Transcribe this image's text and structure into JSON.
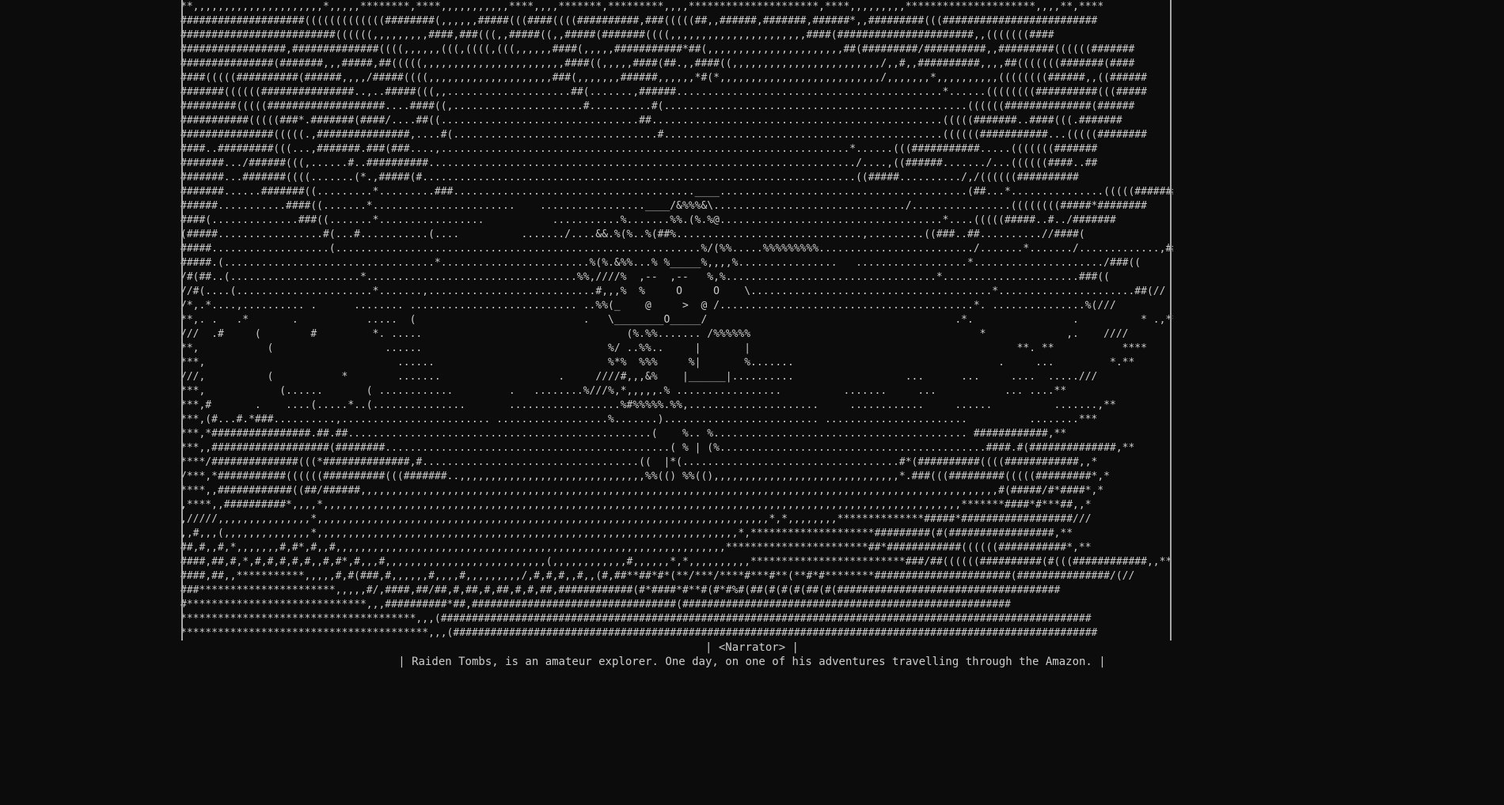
{
  "window": {
    "background": "#0c0c0c",
    "foreground": "#cccccc"
  },
  "art_lines": [
    "**,,,,,,,,,,,,,,,,,,,,,*,,,,,********,****,,,,,,,,,,,****,,,,*******,*********,,,,*********************,****,,,,,,,,,*********************,,,,**,****",
    "####################(((((((((((((########(,,,,,,#####(((####((((##########,###(((((##,,######,#######,######*,,#########(((#########################",
    "#########################((((((,,,,,,,,,####,###(((,,#####((,,#####(#######((((,,,,,,,,,,,,,,,,,,,,,,####(######################,,(((((((####",
    "#################,##############((((,,,,,,(((,((((,(((,,,,,,####(,,,,,###########*##(,,,,,,,,,,,,,,,,,,,,,,##(#########/##########,,#########((((((#######",
    "###############(#######,,,#####,##(((((,,,,,,,,,,,,,,,,,,,,,,,####((,,,,,####(##.,,####((,,,,,,,,,,,,,,,,,,,,,,,,/,,#,,##########,,,,##(((((((#######(####",
    "####(((((##########(######,,,,/#####((((,,,,,,,,,,,,,,,,,,,,###(,,,,,,,######,,,,,,*#(*,,,,,,,,,,,,,,,,,,,,,,,,,,/,,,,,,,*,,,,,,,,,,((((((((######,,((######",
    "#######((((((###############..,..#####(((,,....................##(.......,######...........................................*......((((((((##########(((#####",
    "#########(((((###################....####((,.....................#..........#(.................................................((((((##############(######",
    "###########(((((###*.#######(####/....##((................................##...............................................(((((#######..####(((.#######",
    "###############(((((.,###############,....#(.................................#.............................................((((((###########...(((((########",
    "####..#########(((...,#######.###(###....,..................................................................*......(((###########.....(((((((#######",
    "#######.../######(((,......#..##########...................................................................../....,((######......./...((((((####..##",
    "#######...#######((((.......(*.,#####(#......................................................................((#####........../,/((((((##########",
    "#######......#######((.........*.........###.......................................____........................................(##...*...............(((((###########",
    "######...........####((.......*.......................    .................____/&%%%&\\.............................../................((((((((#####*########",
    "####(..............###((.......*.................           ...........%.......%%.(%.%@....................................*....(((((#####..#../#######",
    "(#####.................#(...#...........(....          ......./....&&.%(%..%(##%..............................,.........((###..##..........//####(",
    "#####...................(...........................................................%/(%%.....%%%%%%%%%........................./.......*......./.............,#####(",
    "#####.(..................................*........................%(%.&%%...% %_____%,,,,%................   ..................*...................../###((",
    "/#(##..(.....................*..................................%%,////%  ,--  ,--   %,%..................................*......................###((",
    "//#(....(......................*.......,...........................#,,,%  %     O     O    \\.......................................*......................##(//",
    "/*,.*....,.......... .      ........ ........................... ..%%(_    @     >  @ /.........................................*. ...............%(///",
    "**,. .   .*       .           .....  (                           .   \\________O_____/                                        .*.                .          * .,**/",
    "///  .#     (        #         *. .....                                 (%.%%....... /%%%%%%                                     *             ,.    ////",
    "**,           (                  ......                              %/ ..%%..     |       |                                           **. **           ****",
    "***,                               ......                            %*%  %%%     %|       %.......                                 .     ...         *.**",
    "///,          (           *        .......                   .     ////#,,,&%    |______|..........                  ...      ...     ....  ...../// ",
    "***,            (......       ( ............         .   ........%///%,*,,,,,.% .................          .......     ...           ... ....**",
    "***,#       .    ....(.....*..(...............       ..................%#%%%%%.%%,.....................     ............     ......          .......,**",
    "***,(#...#.*###..........,........................ ..................%.......)......................... .......................          ........***",
    "***,*################.##.##.................................................(    %.. %......................................... ############,**",
    "***,,###################(########..............................................( % | (%...........................................####.#(##############,**",
    "****/##############(((*##############,#...................................((  |*(...................................#*(##########((((############,,*",
    "/***,*###########((((((##########(((#######..,,,,,,,,,,,,,,,,,,,,,,,,,,,,,,%%(() %%((),,,,,,,,,,,,,,,,,,,,,,,,,,,,,,*.###(((#########(((((#########*,*",
    "****,,############((##/######,,,,,,,,,,,,,,,,,,,,,,,,,,,,,,,,,,,,,,,,,,,,,,,,,,,,,,,,,,,,,,,,,,,,,,,,,,,,,,,,,,,,,,,,,,,,,,,,,,,,,,,#(#####/#*####*,*",
    ",****,,##########*,,,,*,,,,,,,,,,,,,,,,,,,,,,,,,,,,,,,,,,,,,,,,,,,,,,,,,,,,,,,,,,,,,,,,,,,,,,,,,,,,,,,,,,,,,,,,,,,,,,,,,,,,,,,*******####*#***##,,*",
    ",/////,,,,,,,,,,,,,,,*,,,,,,,,,,,,,,,,,,,,,,,,,,,,,,,,,,,,,,,,,,,,,,,,,,,,,,,,,,,,,,,,,,,,,,,,,*,*,,,,,,,,**************#####*##################///",
    ",,#,,,(,,,,,,,,,,,,,,*,,,,,,,,,,,,,,,,,,,,,,,,,,,,,,,,,,,,,,,,,,,,,,,,,,,,,,,,,,,,,,,,,,,,*,********************#########(#(#################,**",
    "##,#,,#,*,,,,,,,#,#*,#,,#,,,,,,,,,,,,,,,,,,,,,,,,,,,,,,,,,,,,,,,,,,,,,,,,,,,,,,,,,,,,,,,***********************##*############((((((###########*,**",
    "####,##,#,*,#,#,#,#,#,,#,#*,#,,,#,,,,,,,,,,,,,,,,,,,,,,,,,,(,,,,,,,,,,,,#,,,,,,*,*,,,,,,,,,,*************************###/##((((((##########(#(((############,,**",
    "####,##,,***********,,,,,#,#(###,#,,,,,,#,,,,#,,,,,,,,,/,#,#,#,,#,,(#,##**##*#*(**/***/****#***#**(**#*#********######################(###############/(//",
    "###**********************,,,,,#/,####,##/##,#,##,#,##,#,#,##,############(#*####*#**#(#*#%#(##(#(#(#(##(#(####################################",
    "#*****************************,,,##########*##,#################################(#####################################################",
    "**************************************,,,(#########################################################################################################",
    "****************************************,,,(########################################################################################################"
  ],
  "narrator": {
    "speaker_tag": "| <Narrator> |",
    "line": "| Raiden Tombs, is an amateur explorer. One day, on one of his adventures travelling through the Amazon. |"
  }
}
